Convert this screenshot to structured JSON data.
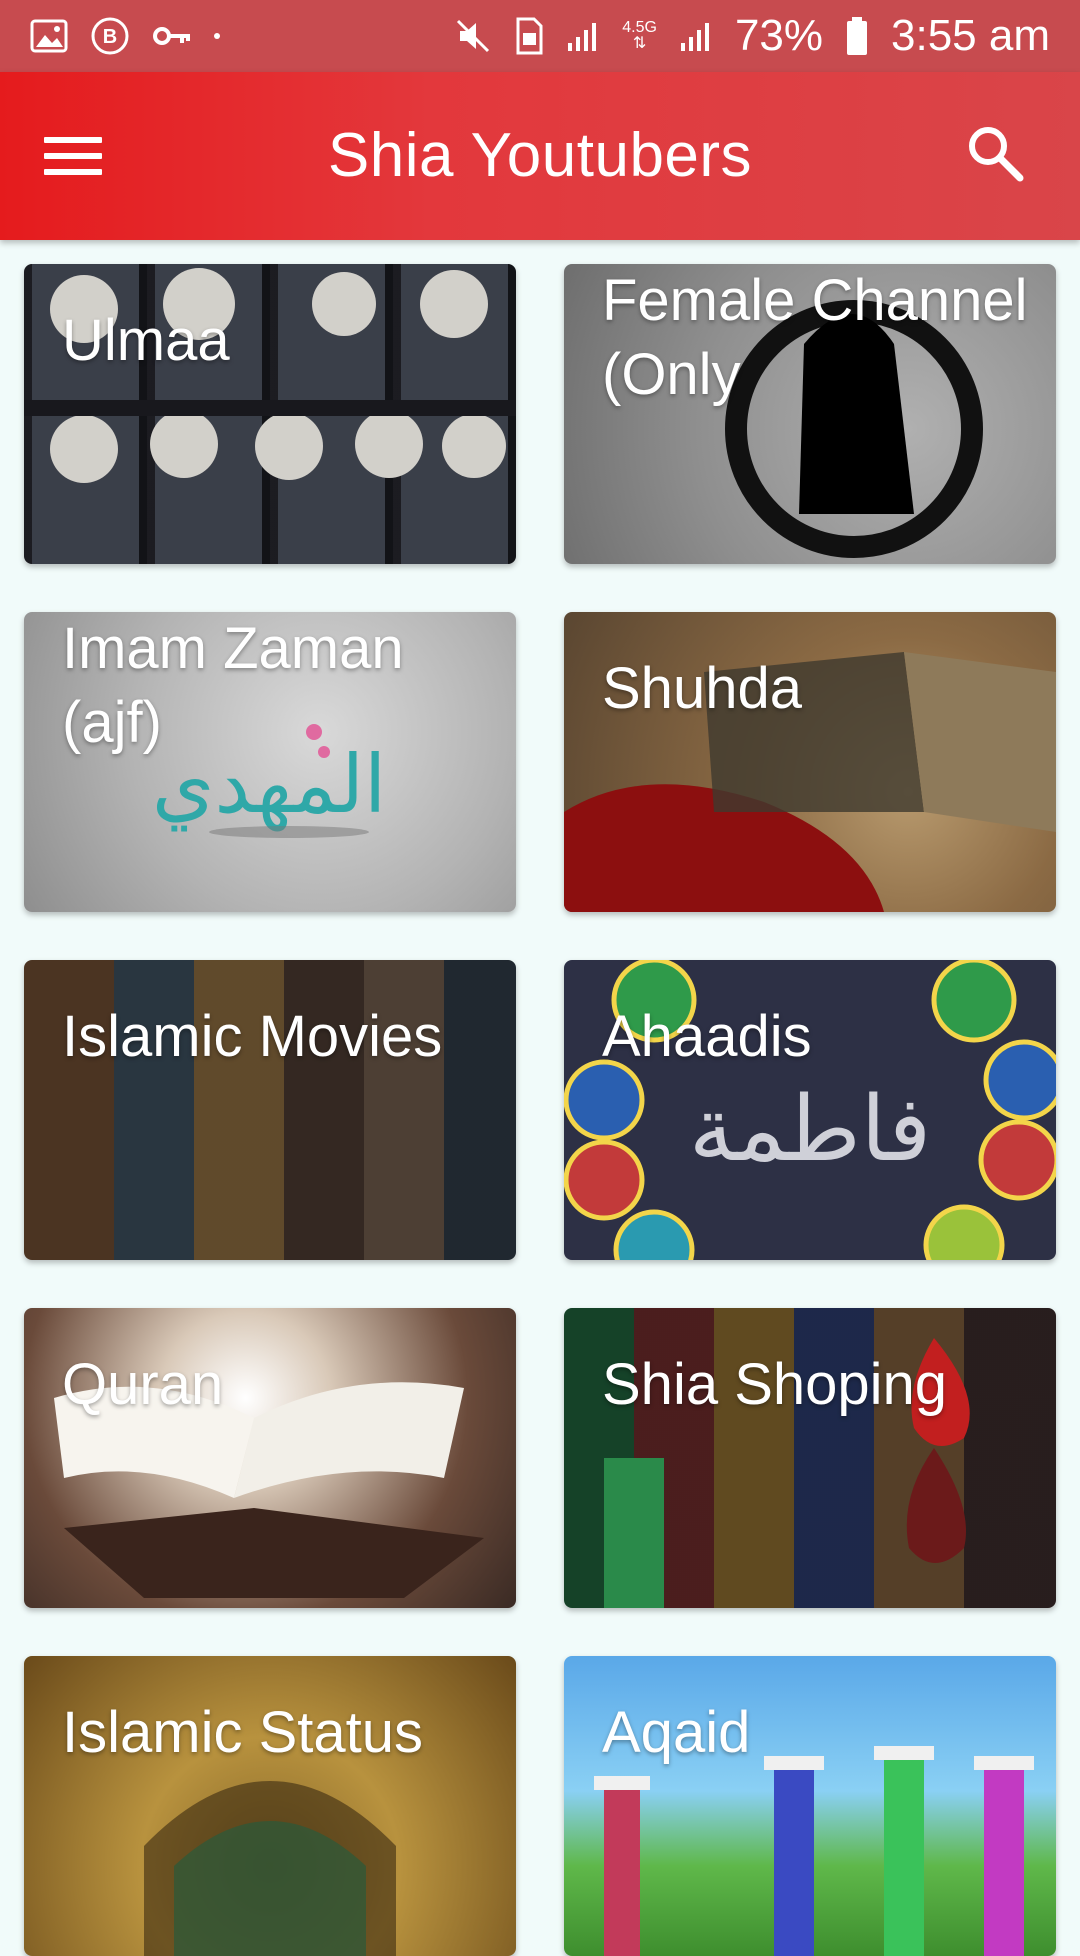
{
  "status_bar": {
    "battery": "73%",
    "time": "3:55 am",
    "network": "4.5G"
  },
  "app_bar": {
    "title": "Shia Youtubers",
    "menu_icon": "menu-icon",
    "search_icon": "search-icon"
  },
  "categories": [
    {
      "label": "Ulmaa"
    },
    {
      "label": "Female Channel (Only"
    },
    {
      "label": "Imam Zaman (ajf)"
    },
    {
      "label": "Shuhda"
    },
    {
      "label": "Islamic Movies"
    },
    {
      "label": "Ahaadis"
    },
    {
      "label": "Quran"
    },
    {
      "label": "Shia Shoping"
    },
    {
      "label": "Islamic Status"
    },
    {
      "label": "Aqaid"
    }
  ],
  "colors": {
    "status_bar": "#c74b4f",
    "app_bar": "#e51b1d",
    "background": "#f1fbfa"
  }
}
